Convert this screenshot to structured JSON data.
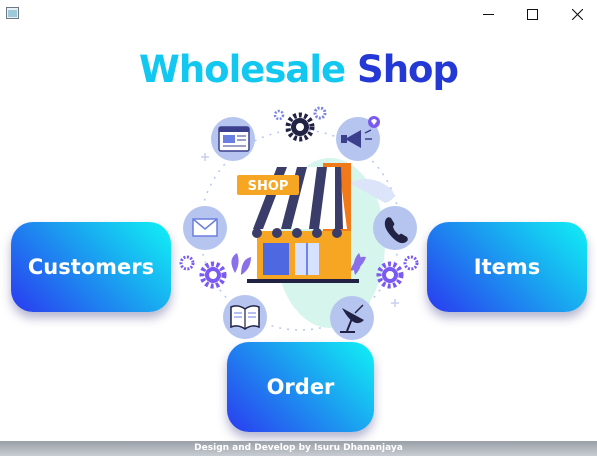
{
  "window": {
    "app_icon": "window-app-icon",
    "controls": [
      "minimize-icon",
      "maximize-icon",
      "close-icon"
    ]
  },
  "title": {
    "word1": "Wholesale",
    "word2": "Shop",
    "color1": "#12c8f0",
    "color2": "#2438d6"
  },
  "illustration": {
    "sign": "SHOP",
    "icons": [
      "browser-window-icon",
      "gear-icon",
      "megaphone-icon",
      "mail-icon",
      "phone-icon",
      "book-icon",
      "satellite-dish-icon"
    ]
  },
  "buttons": {
    "customers": "Customers",
    "items": "Items",
    "order": "Order"
  },
  "footer": {
    "text": "Design and Develop by Isuru Dhananjaya"
  }
}
